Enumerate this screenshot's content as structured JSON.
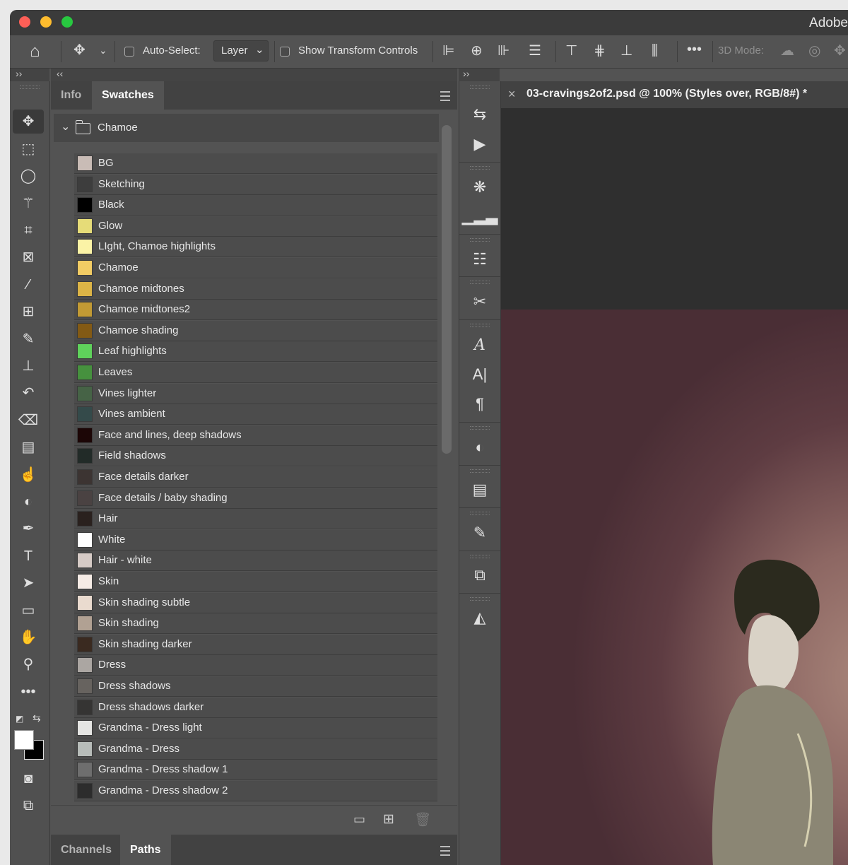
{
  "window": {
    "app_title": "Adobe"
  },
  "options_bar": {
    "auto_select_label": "Auto-Select:",
    "auto_select_value": "Layer",
    "show_transform_label": "Show Transform Controls",
    "mode3d_label": "3D Mode:"
  },
  "swatches_panel": {
    "tabs": [
      "Info",
      "Swatches"
    ],
    "active_tab": "Swatches",
    "group_name": "Chamoe",
    "swatches": [
      {
        "name": "BG",
        "color": "#c9bcb6"
      },
      {
        "name": "Sketching",
        "color": "#3d3d3d"
      },
      {
        "name": "Black",
        "color": "#000000"
      },
      {
        "name": "Glow",
        "color": "#e6dc78"
      },
      {
        "name": "LIght, Chamoe highlights",
        "color": "#fbf3a6"
      },
      {
        "name": "Chamoe",
        "color": "#f2cc64"
      },
      {
        "name": "Chamoe midtones",
        "color": "#dcb446"
      },
      {
        "name": "Chamoe midtones2",
        "color": "#c29a34"
      },
      {
        "name": "Chamoe shading",
        "color": "#835a14"
      },
      {
        "name": "Leaf highlights",
        "color": "#5fd25b"
      },
      {
        "name": "Leaves",
        "color": "#46913e"
      },
      {
        "name": "Vines lighter",
        "color": "#466346"
      },
      {
        "name": "Vines ambient",
        "color": "#344a4a"
      },
      {
        "name": "Face and lines, deep shadows",
        "color": "#1c0606"
      },
      {
        "name": "Field shadows",
        "color": "#222b28"
      },
      {
        "name": "Face details darker",
        "color": "#3c3432"
      },
      {
        "name": "Face details / baby shading",
        "color": "#4a4242"
      },
      {
        "name": "Hair",
        "color": "#2a211e"
      },
      {
        "name": "White",
        "color": "#ffffff"
      },
      {
        "name": "Hair - white",
        "color": "#d6cbc6"
      },
      {
        "name": "Skin",
        "color": "#f6ece6"
      },
      {
        "name": "Skin shading subtle",
        "color": "#eadbcf"
      },
      {
        "name": "Skin shading",
        "color": "#b1a193"
      },
      {
        "name": "Skin shading darker",
        "color": "#3a2a20"
      },
      {
        "name": "Dress",
        "color": "#aba6a2"
      },
      {
        "name": "Dress shadows",
        "color": "#67635f"
      },
      {
        "name": "Dress shadows darker",
        "color": "#353433"
      },
      {
        "name": "Grandma - Dress light",
        "color": "#e5e5e3"
      },
      {
        "name": "Grandma - Dress",
        "color": "#b7bcb9"
      },
      {
        "name": "Grandma - Dress shadow 1",
        "color": "#6e6e6e"
      },
      {
        "name": "Grandma - Dress shadow 2",
        "color": "#2c2c2c"
      }
    ]
  },
  "bottom_panel": {
    "tabs": [
      "Channels",
      "Paths"
    ],
    "active_tab": "Paths"
  },
  "document": {
    "tab_title": "03-cravings2of2.psd @ 100% (Styles over, RGB/8#) *"
  }
}
